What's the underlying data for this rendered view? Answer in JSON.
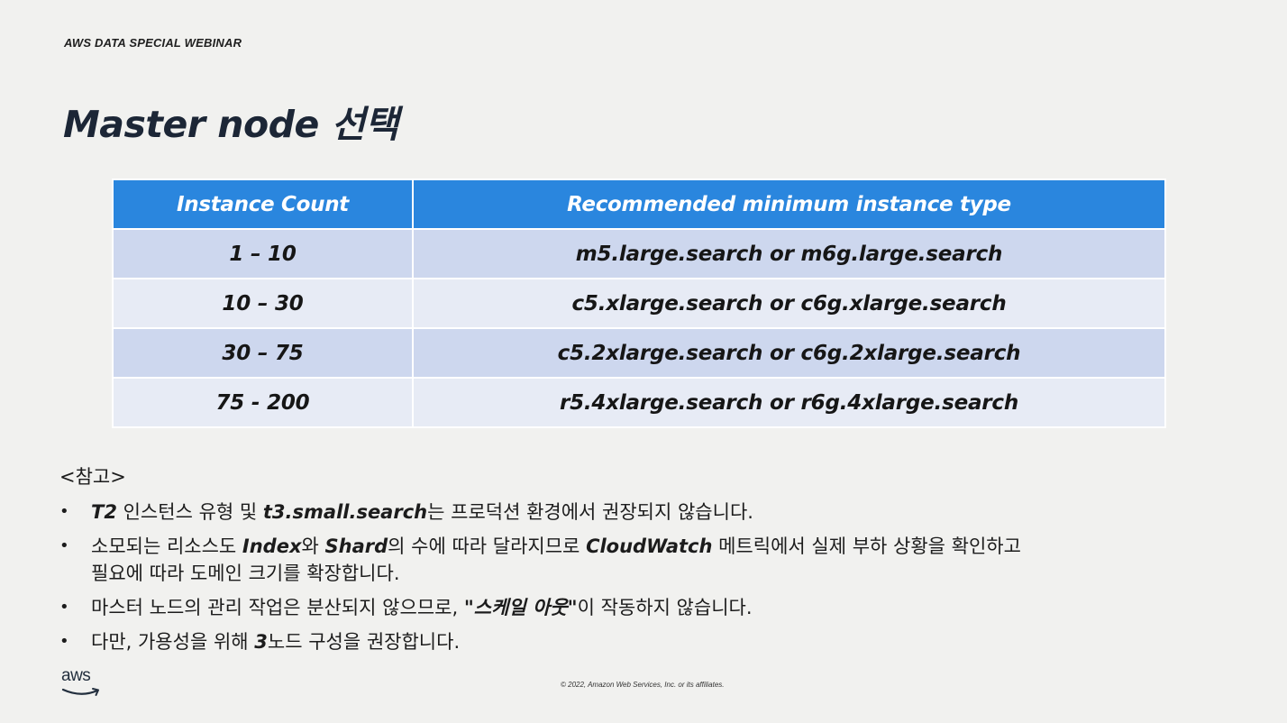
{
  "header": {
    "event_label": "AWS DATA SPECIAL WEBINAR"
  },
  "title": "Master node 선택",
  "table": {
    "headers": [
      "Instance Count",
      "Recommended minimum instance type"
    ],
    "rows": [
      [
        "1 – 10",
        "m5.large.search or m6g.large.search"
      ],
      [
        "10 – 30",
        "c5.xlarge.search or c6g.xlarge.search"
      ],
      [
        "30 – 75",
        "c5.2xlarge.search or c6g.2xlarge.search"
      ],
      [
        "75 - 200",
        "r5.4xlarge.search or r6g.4xlarge.search"
      ]
    ],
    "colors": {
      "header_bg": "#2a86de",
      "row_odd": "#cdd7ee",
      "row_even": "#e7ebf5"
    }
  },
  "notes": {
    "heading": "<참고>",
    "bullet_symbol": "•",
    "items": [
      [
        {
          "b": "T2"
        },
        {
          "t": " 인스턴스 유형 및 "
        },
        {
          "b": "t3.small.search"
        },
        {
          "t": "는 프로덕션 환경에서 권장되지 않습니다."
        }
      ],
      [
        {
          "t": "소모되는 리소스도 "
        },
        {
          "b": "Index"
        },
        {
          "t": "와 "
        },
        {
          "b": "Shard"
        },
        {
          "t": "의 수에 따라 달라지므로 "
        },
        {
          "b": "CloudWatch"
        },
        {
          "t": " 메트릭에서 실제 부하 상황을 확인하고"
        },
        {
          "br": true
        },
        {
          "t": "필요에 따라 도메인 크기를 확장합니다."
        }
      ],
      [
        {
          "t": "마스터 노드의 관리 작업은 분산되지 않으므로, "
        },
        {
          "b": "\"스케일 아웃\""
        },
        {
          "t": "이 작동하지 않습니다."
        }
      ],
      [
        {
          "t": "다만, 가용성을 위해 "
        },
        {
          "b": "3"
        },
        {
          "t": "노드 구성을 권장합니다."
        }
      ]
    ]
  },
  "footer": {
    "logo_text": "aws",
    "logo_icon": "aws-smile-arrow",
    "copyright": "© 2022, Amazon Web Services, Inc. or its affiliates."
  }
}
